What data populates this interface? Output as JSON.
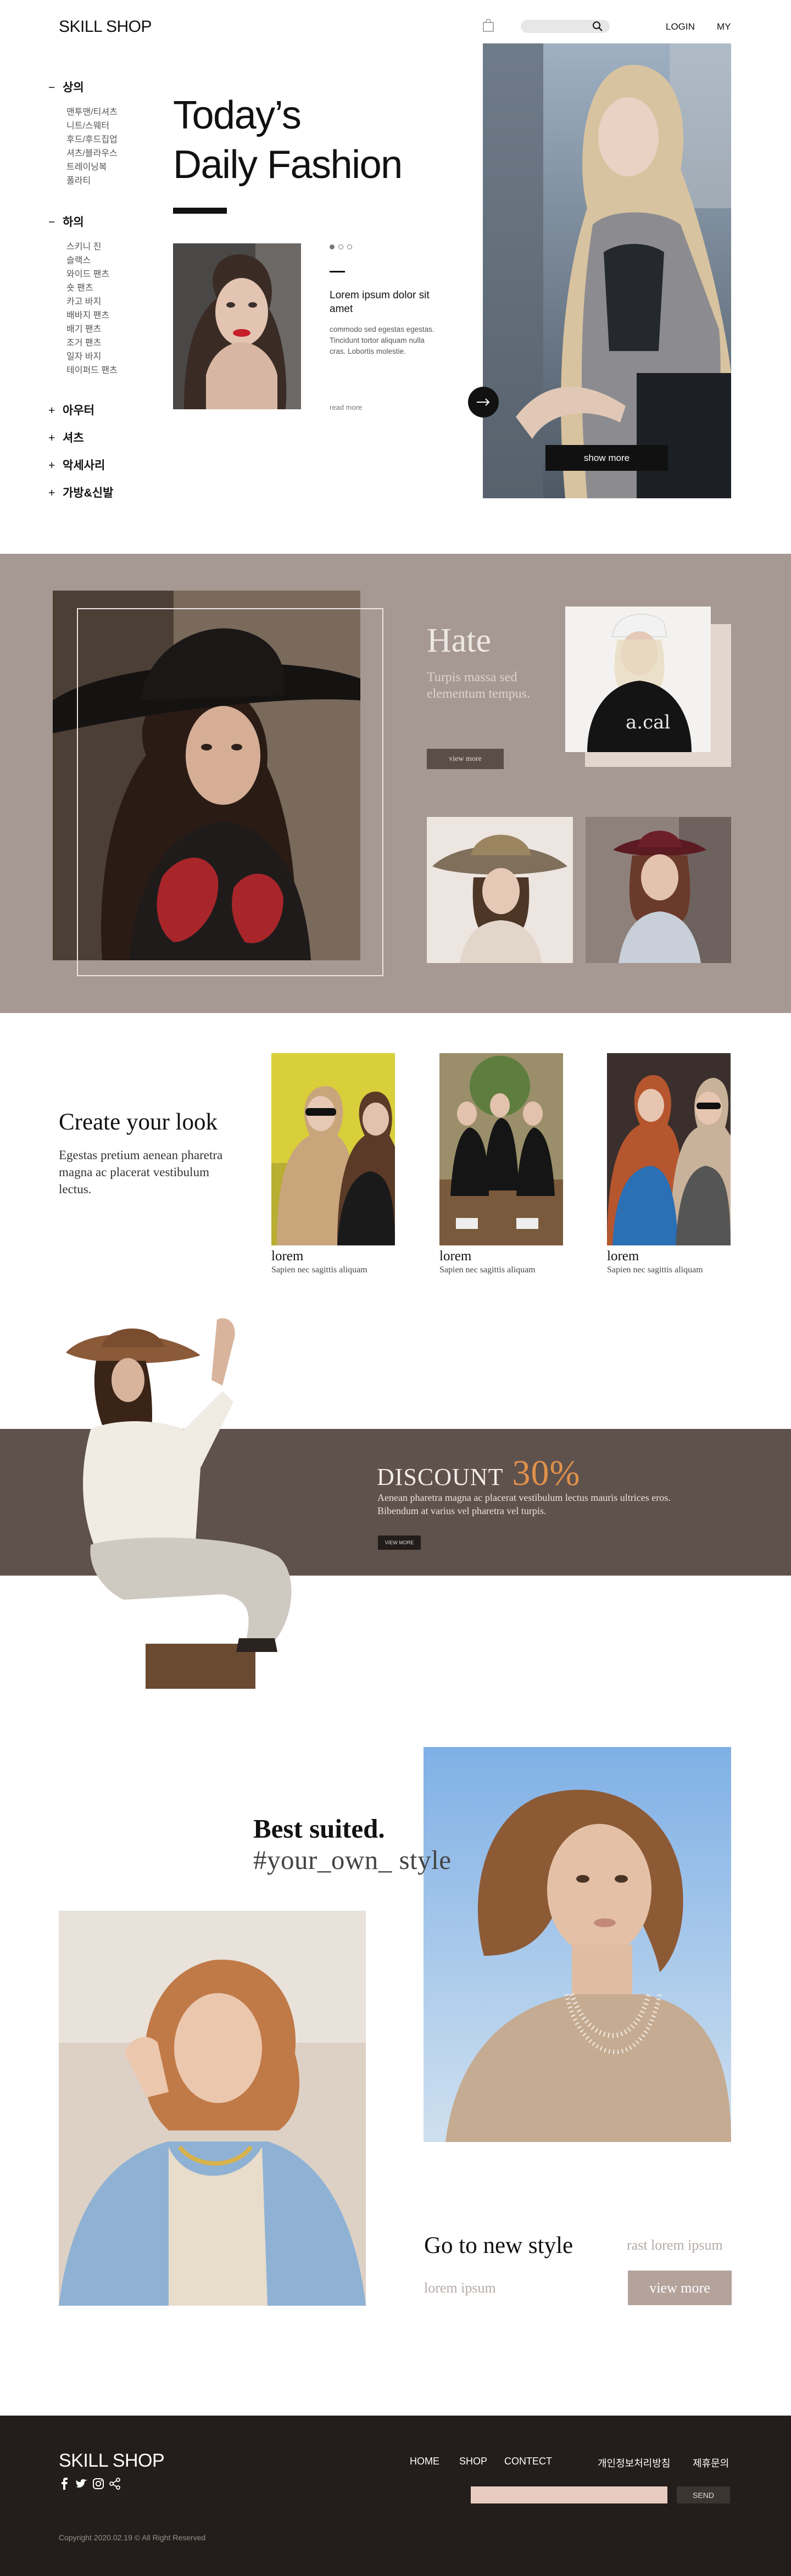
{
  "header": {
    "logo": "SKILL SHOP",
    "login": "LOGIN",
    "my": "MY"
  },
  "sidebar": {
    "categories": [
      {
        "label": "상의",
        "mark": "−",
        "items": [
          "맨투맨/티셔츠",
          "니트/스웨터",
          "후드/후드집업",
          "셔츠/블라우스",
          "트레이닝복",
          "폴라티"
        ]
      },
      {
        "label": "하의",
        "mark": "−",
        "items": [
          "스키니 진",
          "슬랙스",
          "와이드 팬츠",
          "숏 팬츠",
          "카고 바지",
          "배바지 팬츠",
          "배기 팬츠",
          "조거 팬츠",
          "일자 바지",
          "테이퍼드 팬츠"
        ]
      },
      {
        "label": "아우터",
        "mark": "+"
      },
      {
        "label": "셔츠",
        "mark": "+"
      },
      {
        "label": "악세사리",
        "mark": "+"
      },
      {
        "label": "가방&신발",
        "mark": "+"
      }
    ]
  },
  "hero": {
    "title_line1": "Today’s",
    "title_line2": "Daily Fashion",
    "card_title": "Lorem ipsum dolor sit amet",
    "card_body": "commodo sed egestas egestas. Tincidunt tortor aliquam nulla cras. Lobortis molestie.",
    "read_more": "read more",
    "show_more": "show more"
  },
  "hate": {
    "title": "Hate",
    "subtitle": "Turpis massa sed elementum tempus.",
    "button": "view more"
  },
  "look": {
    "title": "Create your look",
    "body": "Egestas pretium aenean pharetra magna ac placerat vestibulum lectus.",
    "cards": [
      {
        "title": "lorem",
        "caption": "Sapien nec sagittis aliquam"
      },
      {
        "title": "lorem",
        "caption": "Sapien nec sagittis aliquam"
      },
      {
        "title": "lorem",
        "caption": "Sapien nec sagittis aliquam"
      }
    ]
  },
  "discount": {
    "label": "DISCOUNT",
    "percent": "30%",
    "body": "Aenean pharetra magna ac placerat vestibulum lectus mauris ultrices eros. Bibendum at varius vel pharetra vel turpis.",
    "button": "VIEW MORE"
  },
  "best": {
    "title": "Best suited.",
    "tagline": "#your_own_ style",
    "go_title": "Go to new style",
    "side_text": "rast lorem ipsum",
    "lorem": "lorem ipsum",
    "button": "view more"
  },
  "footer": {
    "logo": "SKILL SHOP",
    "nav": [
      "HOME",
      "SHOP",
      "CONTECT"
    ],
    "policy": "개인정보처리방침",
    "inquiry": "제휴문의",
    "send": "SEND",
    "copyright": "Copyright 2020.02.19 © All Right Reserved"
  },
  "colors": {
    "taupe_bg": "#a69892",
    "discount_bg": "#5f524d",
    "accent_orange": "#e0914a",
    "footer_bg": "#231d1b"
  }
}
